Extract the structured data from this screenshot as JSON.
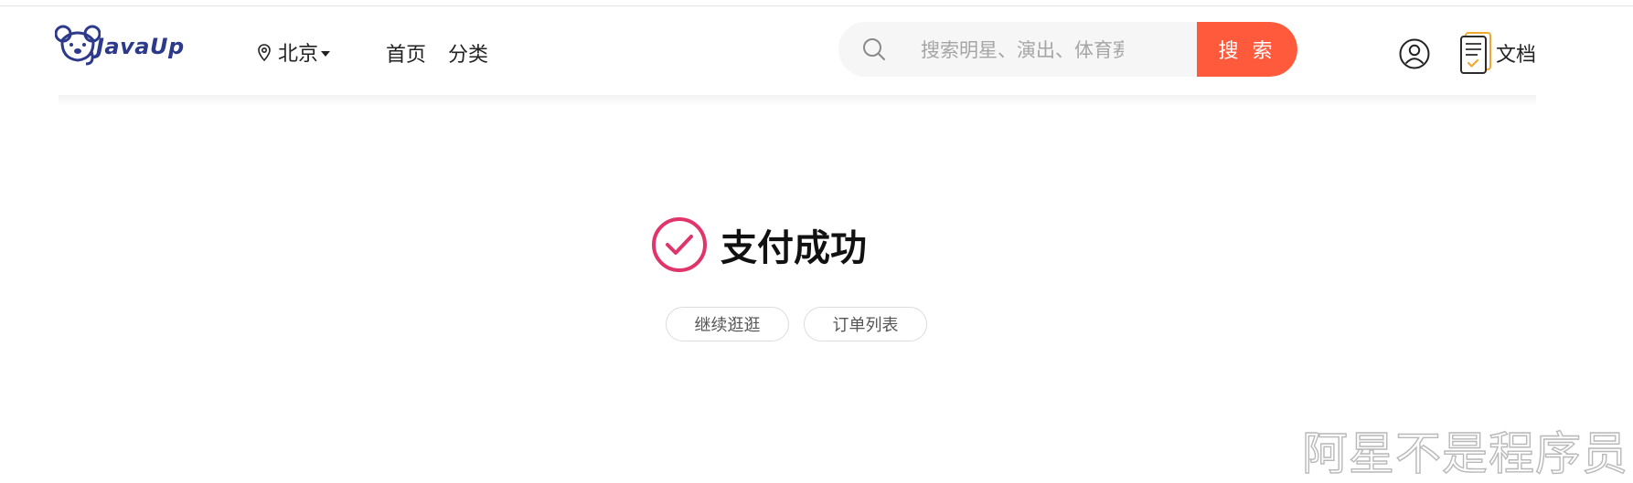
{
  "header": {
    "logo_text": "JavaUp",
    "city": "北京",
    "nav": [
      {
        "label": "首页"
      },
      {
        "label": "分类"
      }
    ],
    "search": {
      "placeholder": "搜索明星、演出、体育赛事",
      "value": "",
      "button_label": "搜 索"
    },
    "docs_label": "文档"
  },
  "main": {
    "status_title": "支付成功",
    "buttons": [
      {
        "label": "继续逛逛"
      },
      {
        "label": "订单列表"
      }
    ]
  },
  "watermark": "阿星不是程序员",
  "colors": {
    "accent": "#ff5a3c",
    "success": "#e0356b",
    "logo": "#2d3a8c",
    "docs_icon_accent": "#f0a830"
  },
  "icons": [
    "koala-logo",
    "location-pin-icon",
    "caret-down-icon",
    "search-icon",
    "user-icon",
    "document-icon",
    "check-circle-icon"
  ]
}
